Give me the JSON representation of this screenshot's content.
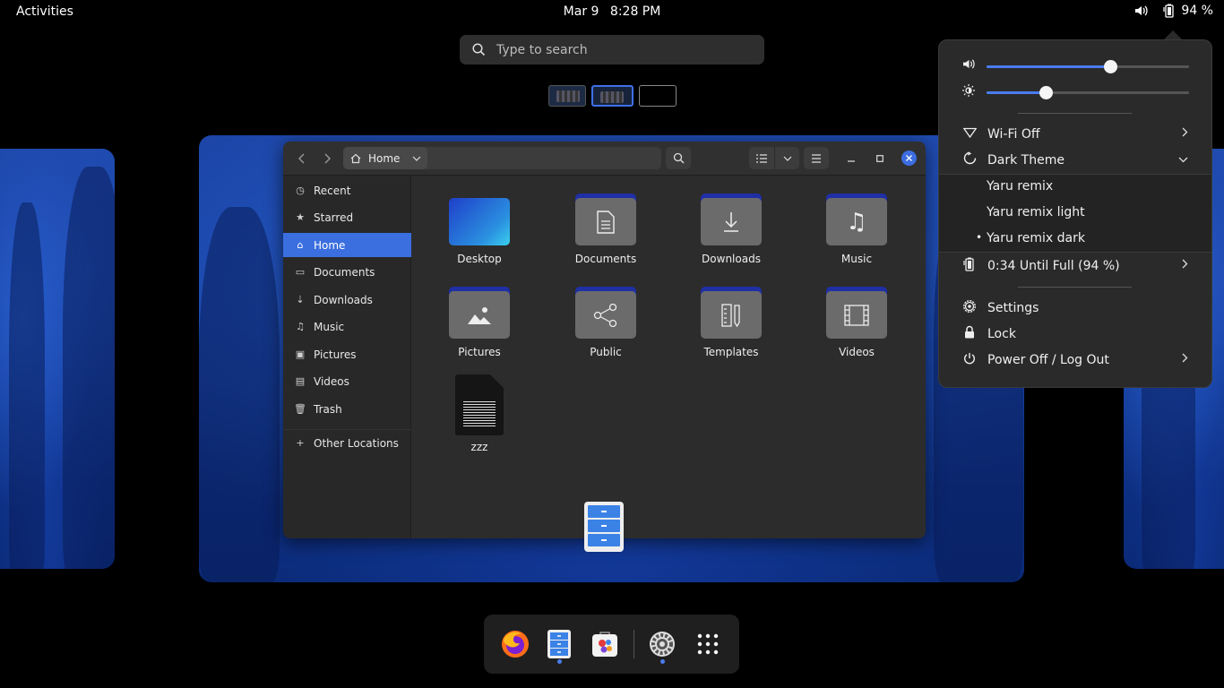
{
  "topbar": {
    "activities": "Activities",
    "date": "Mar 9",
    "time": "8:28 PM",
    "battery_percent": "94 %"
  },
  "search": {
    "placeholder": "Type to search"
  },
  "file_manager": {
    "location": "Home",
    "sidebar": [
      {
        "label": "Recent",
        "icon": "clock-icon"
      },
      {
        "label": "Starred",
        "icon": "star-icon"
      },
      {
        "label": "Home",
        "icon": "home-icon",
        "active": true
      },
      {
        "label": "Documents",
        "icon": "document-icon"
      },
      {
        "label": "Downloads",
        "icon": "download-icon"
      },
      {
        "label": "Music",
        "icon": "music-icon"
      },
      {
        "label": "Pictures",
        "icon": "picture-icon"
      },
      {
        "label": "Videos",
        "icon": "video-icon"
      },
      {
        "label": "Trash",
        "icon": "trash-icon"
      }
    ],
    "other_locations": "Other Locations",
    "files": [
      {
        "label": "Desktop",
        "type": "desktop-folder"
      },
      {
        "label": "Documents",
        "type": "folder",
        "glyph": "document-icon"
      },
      {
        "label": "Downloads",
        "type": "folder",
        "glyph": "download-icon"
      },
      {
        "label": "Music",
        "type": "folder",
        "glyph": "music-icon"
      },
      {
        "label": "Pictures",
        "type": "folder",
        "glyph": "picture-icon"
      },
      {
        "label": "Public",
        "type": "folder",
        "glyph": "share-icon"
      },
      {
        "label": "Templates",
        "type": "folder",
        "glyph": "template-icon"
      },
      {
        "label": "Videos",
        "type": "folder",
        "glyph": "video-icon"
      },
      {
        "label": "zzz",
        "type": "text-file"
      }
    ]
  },
  "quick_settings": {
    "volume_level": 0.61,
    "brightness_level": 0.29,
    "wifi": "Wi-Fi Off",
    "dark_theme": "Dark Theme",
    "themes": [
      {
        "label": "Yaru remix",
        "selected": false
      },
      {
        "label": "Yaru remix light",
        "selected": false
      },
      {
        "label": "Yaru remix dark",
        "selected": true
      }
    ],
    "battery": "0:34 Until Full (94 %)",
    "settings": "Settings",
    "lock": "Lock",
    "power": "Power Off / Log Out"
  },
  "dock": {
    "apps": [
      "firefox-icon",
      "files-icon",
      "software-icon",
      "settings-icon",
      "app-grid-icon"
    ]
  },
  "colors": {
    "accent": "#3b6fe0",
    "panel": "#2a2a2a",
    "folder_tab": "#1f2fa6"
  }
}
